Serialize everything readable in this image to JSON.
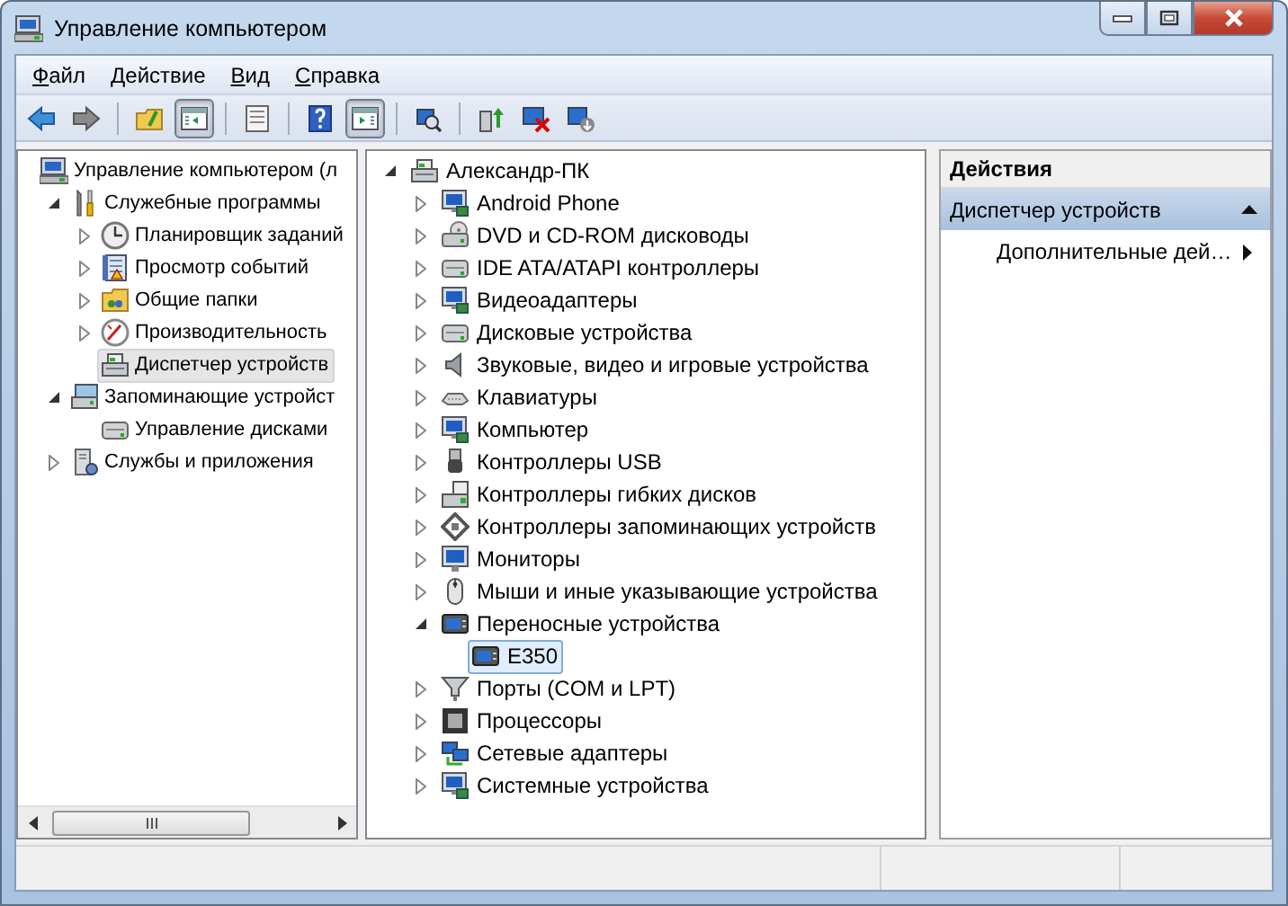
{
  "window": {
    "title": "Управление компьютером"
  },
  "menu": [
    {
      "label": "Файл"
    },
    {
      "label": "Действие"
    },
    {
      "label": "Вид"
    },
    {
      "label": "Справка"
    }
  ],
  "toolbar": [
    {
      "kind": "button",
      "on": false
    },
    {
      "kind": "button",
      "on": false
    },
    {
      "kind": "separator"
    },
    {
      "kind": "button",
      "on": false
    },
    {
      "kind": "button",
      "on": true
    },
    {
      "kind": "separator"
    },
    {
      "kind": "button",
      "on": false
    },
    {
      "kind": "separator"
    },
    {
      "kind": "button",
      "on": false
    },
    {
      "kind": "button",
      "on": true
    },
    {
      "kind": "separator"
    },
    {
      "kind": "button",
      "on": false
    },
    {
      "kind": "separator"
    },
    {
      "kind": "button",
      "on": false
    },
    {
      "kind": "button",
      "on": false
    },
    {
      "kind": "button",
      "on": false
    }
  ],
  "console_tree": {
    "items": [
      {
        "label": "Управление компьютером (л",
        "selected": false,
        "children": [
          {
            "label": "Служебные программы",
            "expanded": true,
            "selected": false,
            "children": [
              {
                "label": "Планировщик заданий",
                "expanded": false,
                "selected": false
              },
              {
                "label": "Просмотр событий",
                "expanded": false,
                "selected": false
              },
              {
                "label": "Общие папки",
                "expanded": false,
                "selected": false
              },
              {
                "label": "Производительность",
                "expanded": false,
                "selected": false
              },
              {
                "label": "Диспетчер устройств",
                "selected": true
              }
            ]
          },
          {
            "label": "Запоминающие устройст",
            "expanded": true,
            "selected": false,
            "children": [
              {
                "label": "Управление дисками",
                "selected": false
              }
            ]
          },
          {
            "label": "Службы и приложения",
            "expanded": false,
            "selected": false
          }
        ]
      }
    ]
  },
  "device_tree": {
    "items": [
      {
        "label": "Александр-ПК",
        "expanded": true,
        "selected": false,
        "children": [
          {
            "label": "Android Phone",
            "expanded": false,
            "selected": false
          },
          {
            "label": "DVD и CD-ROM дисководы",
            "expanded": false,
            "selected": false
          },
          {
            "label": "IDE ATA/ATAPI контроллеры",
            "expanded": false,
            "selected": false
          },
          {
            "label": "Видеоадаптеры",
            "expanded": false,
            "selected": false
          },
          {
            "label": "Дисковые устройства",
            "expanded": false,
            "selected": false
          },
          {
            "label": "Звуковые, видео и игровые устройства",
            "expanded": false,
            "selected": false
          },
          {
            "label": "Клавиатуры",
            "expanded": false,
            "selected": false
          },
          {
            "label": "Компьютер",
            "expanded": false,
            "selected": false
          },
          {
            "label": "Контроллеры USB",
            "expanded": false,
            "selected": false
          },
          {
            "label": "Контроллеры гибких дисков",
            "expanded": false,
            "selected": false
          },
          {
            "label": "Контроллеры запоминающих устройств",
            "expanded": false,
            "selected": false
          },
          {
            "label": "Мониторы",
            "expanded": false,
            "selected": false
          },
          {
            "label": "Мыши и иные указывающие устройства",
            "expanded": false,
            "selected": false
          },
          {
            "label": "Переносные устройства",
            "expanded": true,
            "selected": false,
            "children": [
              {
                "label": "E350",
                "selected": true
              }
            ]
          },
          {
            "label": "Порты (COM и LPT)",
            "expanded": false,
            "selected": false
          },
          {
            "label": "Процессоры",
            "expanded": false,
            "selected": false
          },
          {
            "label": "Сетевые адаптеры",
            "expanded": false,
            "selected": false
          },
          {
            "label": "Системные устройства",
            "expanded": false,
            "selected": false
          }
        ]
      }
    ]
  },
  "actions": {
    "title": "Действия",
    "sections": [
      {
        "label": "Диспетчер устройств",
        "expanded": true,
        "items": [
          {
            "label": "Дополнительные дей…"
          }
        ]
      }
    ]
  }
}
